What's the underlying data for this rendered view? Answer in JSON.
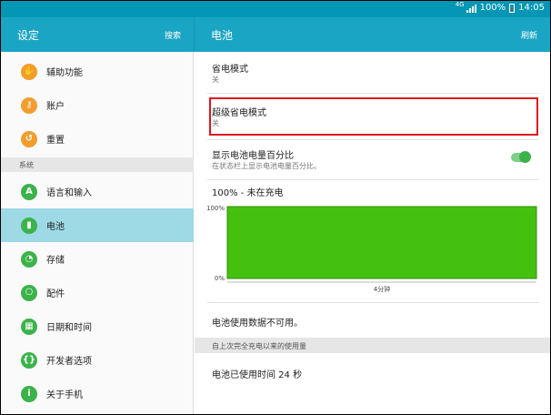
{
  "status_bar": {
    "network": "4G",
    "battery_percent": "100%",
    "time": "14:05",
    "icons": [
      "signal-icon",
      "battery-icon"
    ]
  },
  "left_header": {
    "title": "设定",
    "action": "搜索"
  },
  "right_header": {
    "title": "电池",
    "action": "刷新"
  },
  "sidebar": {
    "items_top": [
      {
        "label": "辅助功能",
        "icon": "hand-icon",
        "color": "#f29d2c"
      },
      {
        "label": "账户",
        "icon": "key-icon",
        "color": "#f29d2c"
      },
      {
        "label": "重置",
        "icon": "reset-icon",
        "color": "#f29d2c"
      }
    ],
    "section_label": "系统",
    "items_bottom": [
      {
        "label": "语言和输入",
        "icon": "language-icon",
        "color": "#3bb34a"
      },
      {
        "label": "电池",
        "icon": "battery-icon",
        "color": "#3bb34a",
        "active": true
      },
      {
        "label": "存储",
        "icon": "storage-icon",
        "color": "#3bb34a"
      },
      {
        "label": "配件",
        "icon": "accessory-icon",
        "color": "#3bb34a"
      },
      {
        "label": "日期和时间",
        "icon": "calendar-icon",
        "color": "#3bb34a"
      },
      {
        "label": "开发者选项",
        "icon": "developer-icon",
        "color": "#3bb34a"
      },
      {
        "label": "关于手机",
        "icon": "info-icon",
        "color": "#3bb34a"
      }
    ]
  },
  "content": {
    "power_saving": {
      "title": "省电模式",
      "value": "关"
    },
    "ultra_power_saving": {
      "title": "超级省电模式",
      "value": "关"
    },
    "show_percentage": {
      "title": "显示电池电量百分比",
      "subtitle": "在状态栏上显示电池电量百分比。",
      "enabled": true
    },
    "battery_status": "100% - 未在充电",
    "usage_unavailable": "电池使用数据不可用。",
    "section_label": "自上次完全充电以来的使用量",
    "usage_time": "电池已使用时间 24 秒"
  },
  "chart_data": {
    "type": "area",
    "x": [
      0,
      1
    ],
    "y": [
      100,
      100
    ],
    "yticks": [
      "100%",
      "0%"
    ],
    "xticks": [
      "4分钟"
    ],
    "ylim": [
      0,
      100
    ],
    "fill_color": "#44c10f"
  },
  "colors": {
    "accent": "#1ba5c4",
    "status_bar": "#0397b5",
    "active_item": "#9ed9e6",
    "highlight_border": "#e0141e"
  }
}
